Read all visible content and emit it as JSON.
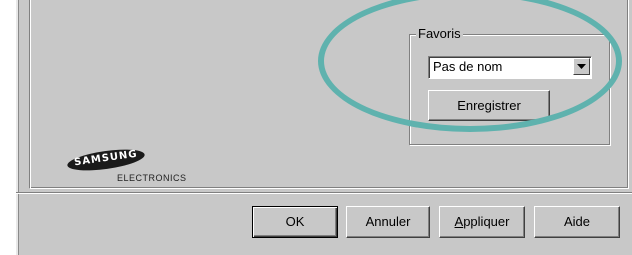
{
  "favorites": {
    "group_title": "Favoris",
    "selected_value": "Pas de nom",
    "save_label": "Enregistrer"
  },
  "logo": {
    "brand": "SAMSUNG",
    "subtitle": "ELECTRONICS"
  },
  "footer": {
    "ok_label": "OK",
    "cancel_label": "Annuler",
    "apply_label": "Appliquer",
    "help_label": "Aide"
  },
  "colors": {
    "dialog_bg": "#c8c8c8",
    "highlight_ring": "#5fb2ae"
  },
  "icons": {
    "dropdown": "chevron-down-icon"
  }
}
